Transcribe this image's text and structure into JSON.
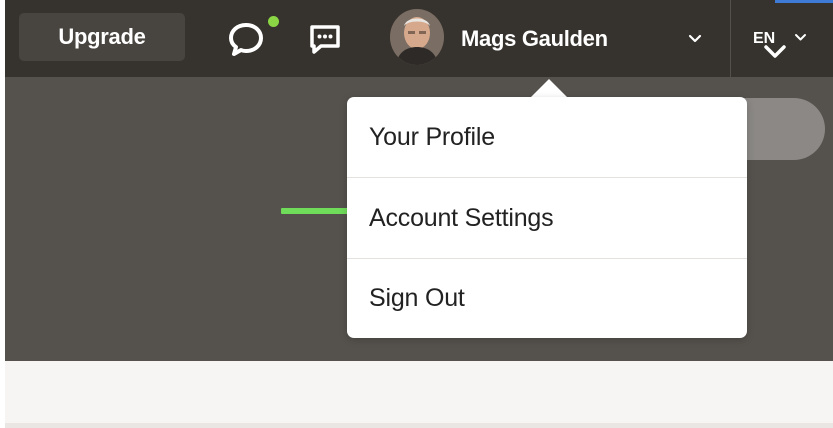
{
  "topbar": {
    "upgrade_label": "Upgrade",
    "user_name": "Mags Gaulden",
    "language": "EN",
    "icons": [
      "chat-bubble-icon",
      "status-dot",
      "feedback-icon",
      "avatar",
      "chevron-down-icon"
    ]
  },
  "dropdown": {
    "items": [
      {
        "label": "Your Profile"
      },
      {
        "label": "Account Settings"
      },
      {
        "label": "Sign Out"
      }
    ]
  },
  "colors": {
    "topbar_bg": "#36322d",
    "content_bg": "#55514d",
    "status_dot": "#8bd645",
    "highlight_marker": "#6fdc5a",
    "menu_bg": "#ffffff"
  }
}
